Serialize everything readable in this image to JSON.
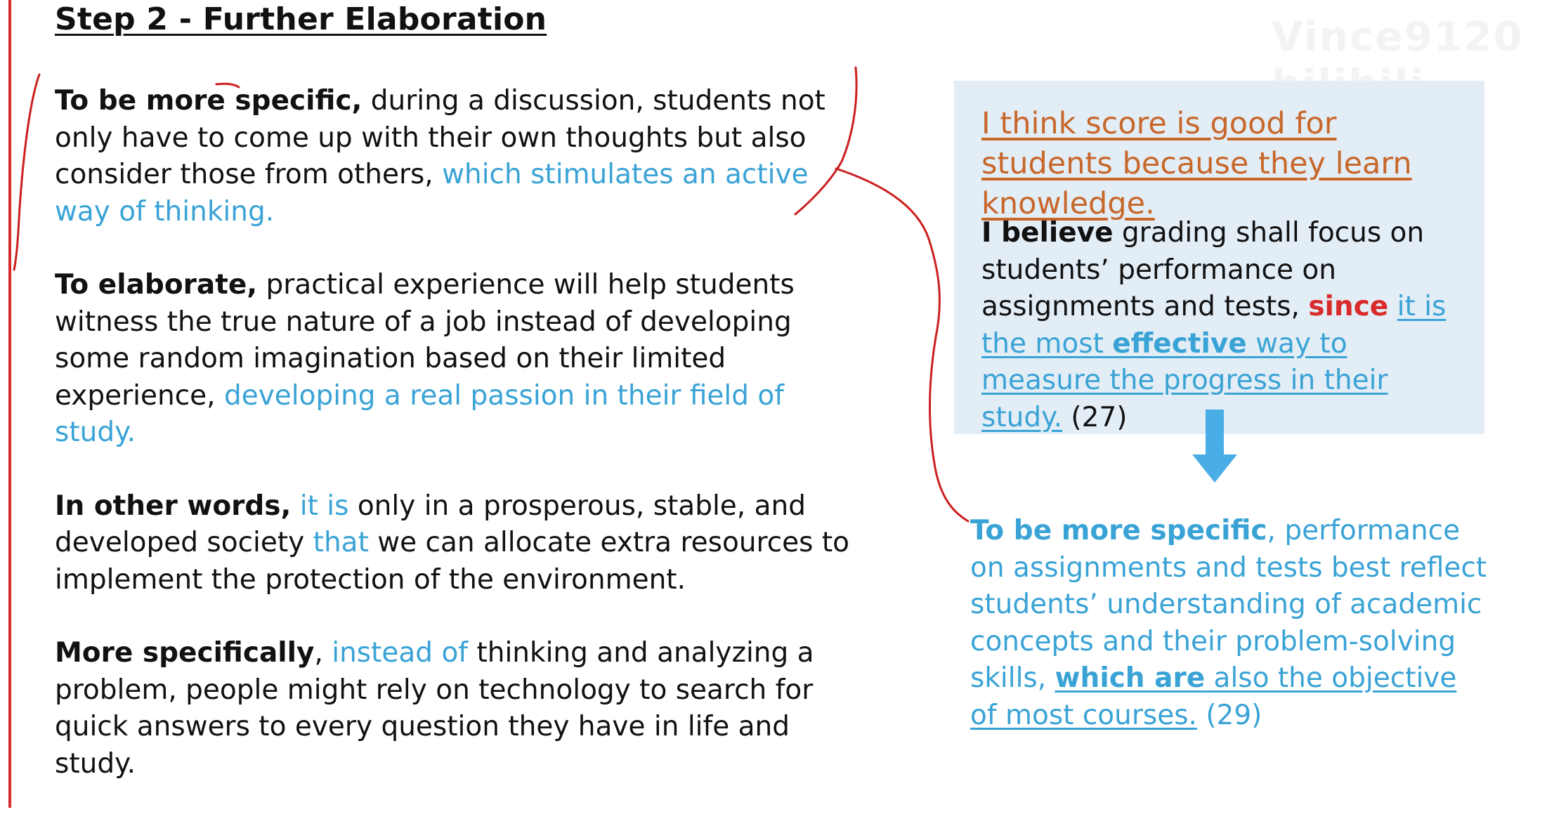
{
  "title": "Step 2 - Further Elaboration",
  "left_paragraphs": [
    {
      "lead": "To be more specific,",
      "text": " during a discussion, students not only have to come up with their own thoughts but also consider those from others, ",
      "blue": "which stimulates an active way of thinking."
    },
    {
      "lead": "To elaborate,",
      "text": " practical experience will help students witness the true nature of a job instead of developing some random imagination based on their limited experience, ",
      "blue": "developing a real passion in their field of study."
    },
    {
      "lead": "In other words,",
      "blue1": "it is",
      "text1": " only in a prosperous, stable, and developed society ",
      "blue2": "that",
      "text2": " we can allocate extra resources to implement the protection of the environment."
    },
    {
      "lead": "More specifically",
      "comma": ", ",
      "blue": "instead of",
      "text": " thinking and analyzing a problem, people might rely on technology to search for quick answers to every question they have in life and study."
    }
  ],
  "box": {
    "claim": "I think score is good for students because they learn knowledge.",
    "lead": "I believe",
    "text": " grading shall focus on students’ performance on assignments and tests, ",
    "since": "since",
    "blue1": "it is the most ",
    "blue_bold": "effective",
    "blue2": " way to measure the progress in their study.",
    "num": " (27)"
  },
  "extension": {
    "lead": "To be more specific",
    "text": ", performance on assignments and tests best reflect students’ understanding of academic concepts and their problem-solving skills, ",
    "bold_u": "which are",
    "u_text": " also the objective of most courses.",
    "num": " (29)"
  },
  "watermark": "Vince9120 bilibili",
  "colors": {
    "accent_blue": "#3aa3d6",
    "red": "#d92b2b",
    "orange": "#c8672a",
    "box_bg": "#e3edf6",
    "arrow": "#4aaee6"
  },
  "icons": [
    "down-arrow-icon"
  ]
}
